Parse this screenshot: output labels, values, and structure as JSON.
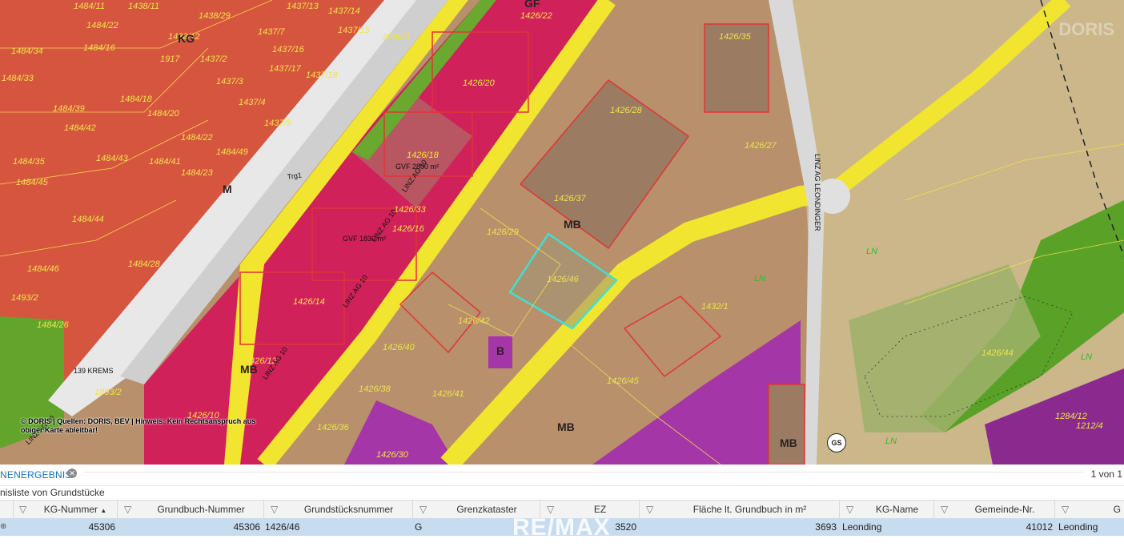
{
  "map": {
    "parcel_labels": [
      {
        "t": "1484/11"
      },
      {
        "t": "1438/11"
      },
      {
        "t": "1438/29"
      },
      {
        "t": "1437/13"
      },
      {
        "t": "1437/14"
      },
      {
        "t": "1484/22"
      },
      {
        "t": "1438/12"
      },
      {
        "t": "1437/7"
      },
      {
        "t": "1437/15"
      },
      {
        "t": "1484/34"
      },
      {
        "t": "1484/16"
      },
      {
        "t": "1437/16"
      },
      {
        "t": "1437/2"
      },
      {
        "t": "1484/33"
      },
      {
        "t": "1917"
      },
      {
        "t": "1437/3"
      },
      {
        "t": "1437/17"
      },
      {
        "t": "1437/18"
      },
      {
        "t": "1437/4"
      },
      {
        "t": "1484/18"
      },
      {
        "t": "1484/39"
      },
      {
        "t": "1484/20"
      },
      {
        "t": "1437/5"
      },
      {
        "t": "1484/42"
      },
      {
        "t": "1484/22"
      },
      {
        "t": "1484/49"
      },
      {
        "t": "1484/35"
      },
      {
        "t": "1484/43"
      },
      {
        "t": "1484/41"
      },
      {
        "t": "1484/23"
      },
      {
        "t": "1484/45"
      },
      {
        "t": "1484/44"
      },
      {
        "t": "1484/28"
      },
      {
        "t": "1484/46"
      },
      {
        "t": "1493/2"
      },
      {
        "t": "1484/26"
      },
      {
        "t": "1426/22"
      },
      {
        "t": "1426/35"
      },
      {
        "t": "1426/20"
      },
      {
        "t": "1426/28"
      },
      {
        "t": "1426/18"
      },
      {
        "t": "1426/37"
      },
      {
        "t": "1426/27"
      },
      {
        "t": "1426/33"
      },
      {
        "t": "1426/29"
      },
      {
        "t": "1426/16"
      },
      {
        "t": "1426/46"
      },
      {
        "t": "1426/14"
      },
      {
        "t": "1426/42"
      },
      {
        "t": "1426/40"
      },
      {
        "t": "1426/12"
      },
      {
        "t": "1432/1"
      },
      {
        "t": "1426/45"
      },
      {
        "t": "1426/38"
      },
      {
        "t": "1426/41"
      },
      {
        "t": "1426/10"
      },
      {
        "t": "1426/36"
      },
      {
        "t": "1426/30"
      },
      {
        "t": "1893/2"
      },
      {
        "t": "1284/12"
      },
      {
        "t": "1212/4"
      },
      {
        "t": "2080/3"
      },
      {
        "t": "1426/44"
      }
    ],
    "zone_labels": [
      {
        "t": "MB"
      },
      {
        "t": "MB"
      },
      {
        "t": "MB"
      },
      {
        "t": "MB"
      },
      {
        "t": "B"
      },
      {
        "t": "M"
      },
      {
        "t": "GF"
      },
      {
        "t": "KG"
      }
    ],
    "ln_labels": [
      {
        "t": "LN"
      },
      {
        "t": "LN"
      },
      {
        "t": "LN"
      },
      {
        "t": "LN"
      }
    ],
    "road_labels": [
      {
        "t": "LINZ AG 10"
      },
      {
        "t": "LINZ AG 10"
      },
      {
        "t": "LINZ AG 10"
      },
      {
        "t": "LINZ AG 10"
      },
      {
        "t": "LINZ AG 10"
      },
      {
        "t": "LINZ AG LEONDINGER"
      },
      {
        "t": "Trg1"
      },
      {
        "t": "139 KREMS"
      },
      {
        "t": "GVF 2800 m²"
      },
      {
        "t": "GVF 1830 m²"
      }
    ],
    "copyright_line1": "© DORIS | Quellen: DORIS, BEV | Hinweis: Kein Rechtsanspruch aus",
    "copyright_line2": "obiger Karte ableitbar!",
    "watermark": "DORIS",
    "badge_gs": "GS"
  },
  "panel": {
    "tab_title": "NENERGEBNIS",
    "pager": "1 von 1",
    "subtitle": "nisliste von Grundstücke",
    "columns": [
      {
        "label": "KG-Nummer",
        "sort": "▲"
      },
      {
        "label": "Grundbuch-Nummer"
      },
      {
        "label": "Grundstücksnummer"
      },
      {
        "label": "Grenzkataster"
      },
      {
        "label": "EZ"
      },
      {
        "label": "Fläche lt. Grundbuch in m²"
      },
      {
        "label": "KG-Name"
      },
      {
        "label": "Gemeinde-Nr."
      },
      {
        "label": "G"
      }
    ],
    "row": {
      "kg_nummer": "45306",
      "grundbuch_nummer": "45306",
      "grundstuecksnummer": "1426/46",
      "grenzkataster": "G",
      "ez": "3520",
      "flaeche": "3693",
      "kg_name": "Leonding",
      "gemeinde_nr": "41012",
      "gemeinde_name": "Leonding"
    },
    "watermark": "RE/MAX"
  },
  "colors": {
    "red_zone": "#d6553f",
    "magenta_zone": "#d0215b",
    "purple_zone": "#a436a8",
    "brown_zone": "#b8906c",
    "green_zone": "#5aa128",
    "road_yellow": "#f1e530",
    "selection": "#3fe0d0"
  }
}
